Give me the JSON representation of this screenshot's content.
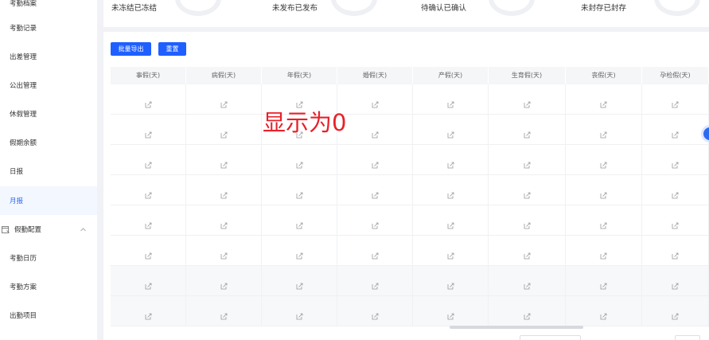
{
  "sidebar": {
    "top_cut_label": "考勤档案",
    "items": [
      {
        "label": "考勤记录"
      },
      {
        "label": "出差管理"
      },
      {
        "label": "公出管理"
      },
      {
        "label": "休假管理"
      },
      {
        "label": "假期余额"
      },
      {
        "label": "日报"
      },
      {
        "label": "月报",
        "active": true
      }
    ],
    "group": {
      "label": "假勤配置",
      "icon": "calendar-icon",
      "expanded": true
    },
    "sub_items": [
      {
        "label": "考勤日历"
      },
      {
        "label": "考勤方案"
      },
      {
        "label": "出勤项目"
      }
    ]
  },
  "stats": {
    "items": [
      {
        "label": "未冻结已冻结"
      },
      {
        "label": "未发布已发布"
      },
      {
        "label": "待确认已确认"
      },
      {
        "label": "未封存已封存"
      }
    ]
  },
  "toolbar": {
    "batch_export_label": "批量导出",
    "reset_label": "重置",
    "accent_color": "#1f5fff"
  },
  "table": {
    "columns": [
      "事假(天)",
      "病假(天)",
      "年假(天)",
      "婚假(天)",
      "产假(天)",
      "生育假(天)",
      "丧假(天)",
      "孕检假(天)"
    ],
    "row_count": 8,
    "cell_icon": "edit-icon"
  },
  "annotation": {
    "text": "显示为0",
    "color": "#e8212a"
  }
}
